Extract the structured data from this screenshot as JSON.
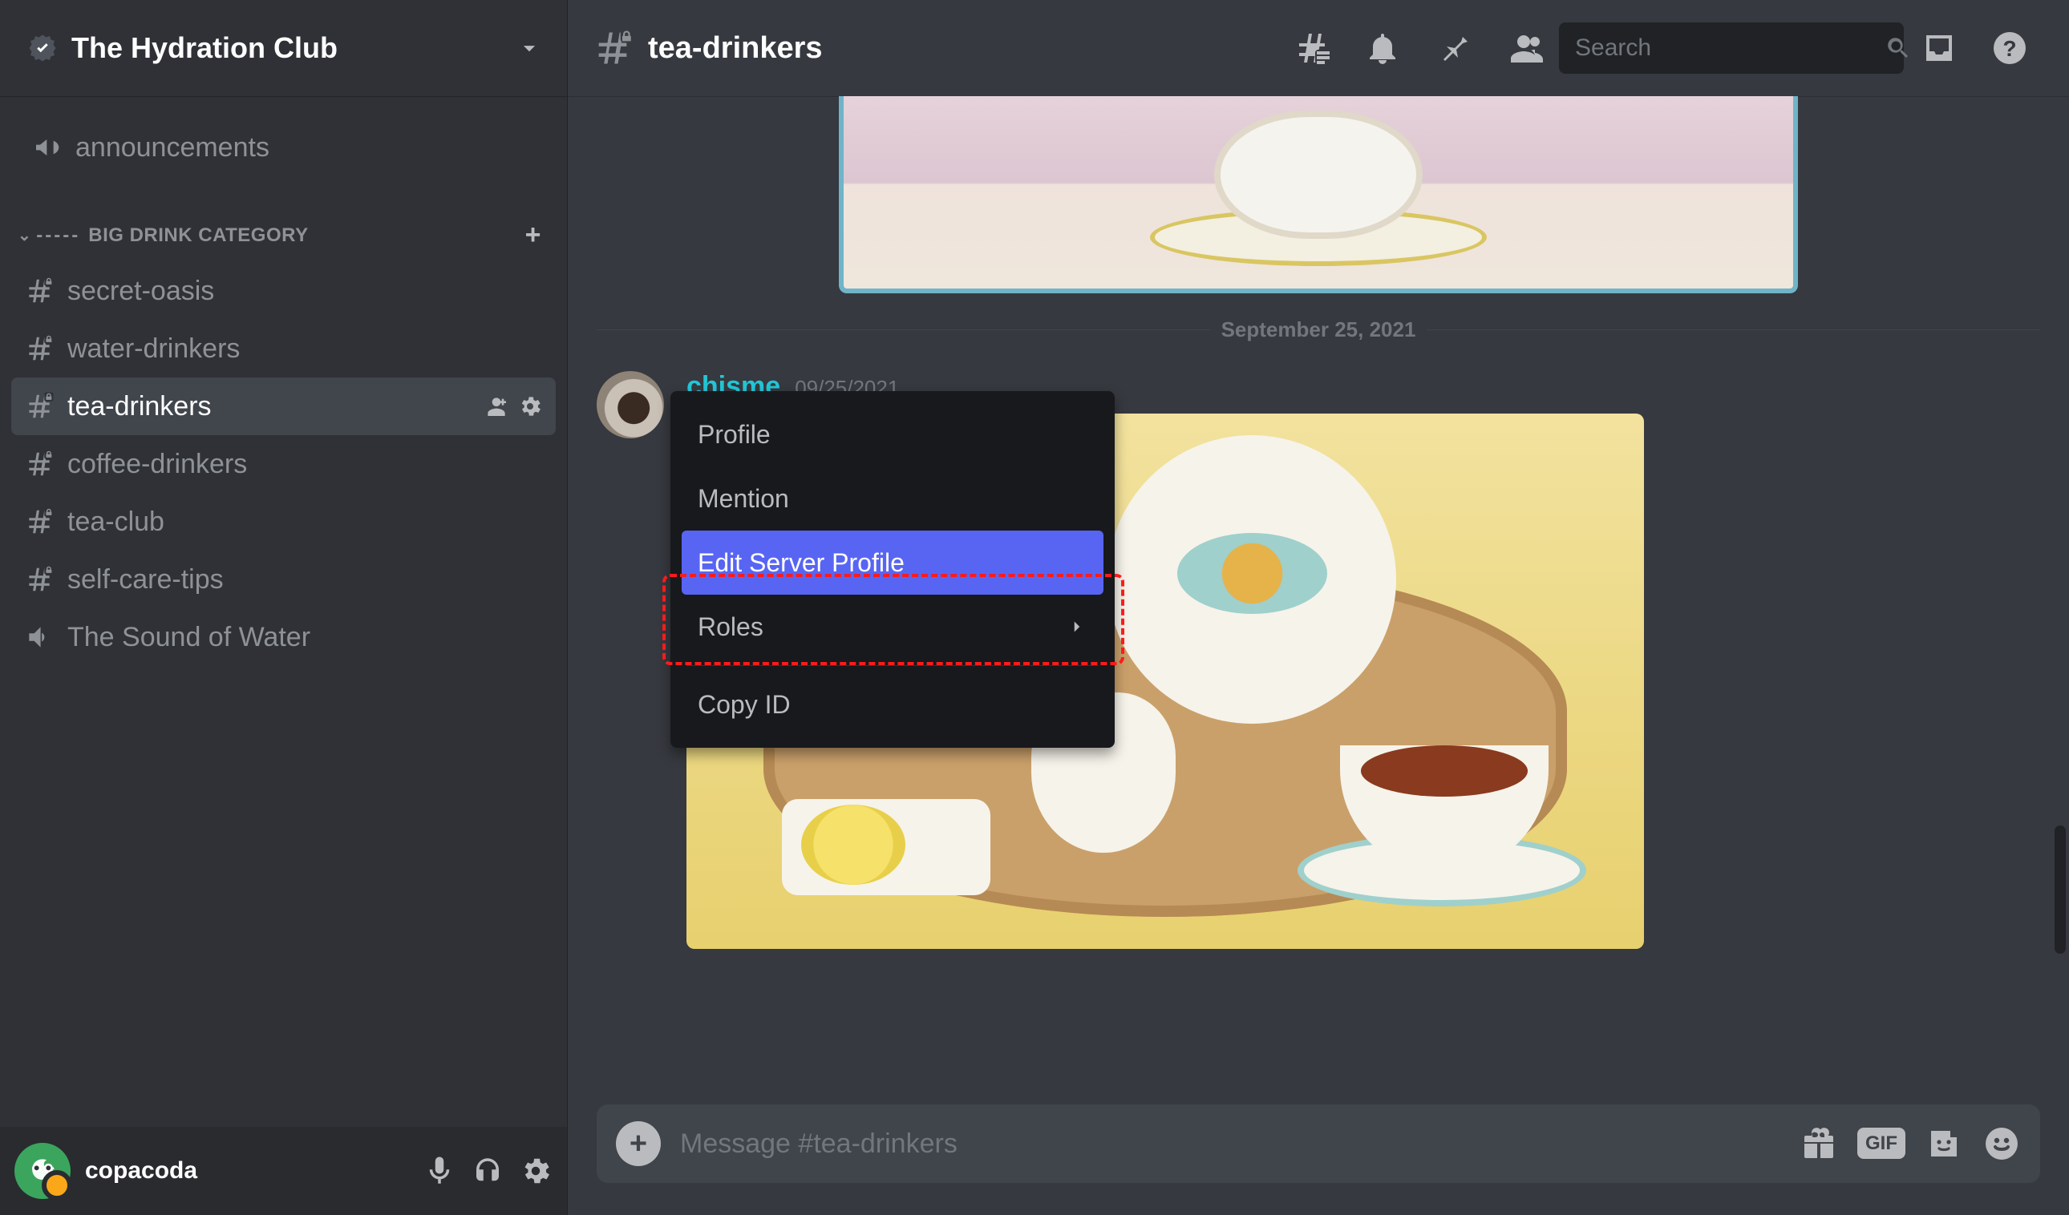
{
  "server": {
    "name": "The Hydration Club"
  },
  "sidebar": {
    "top_channel": {
      "label": "announcements"
    },
    "category": {
      "name": "BIG DRINK CATEGORY",
      "dashes": "-----"
    },
    "channels": [
      {
        "label": "secret-oasis",
        "active": false
      },
      {
        "label": "water-drinkers",
        "active": false
      },
      {
        "label": "tea-drinkers",
        "active": true
      },
      {
        "label": "coffee-drinkers",
        "active": false
      },
      {
        "label": "tea-club",
        "active": false
      },
      {
        "label": "self-care-tips",
        "active": false
      },
      {
        "label": "The Sound of Water",
        "active": false,
        "voice": true
      }
    ]
  },
  "user_panel": {
    "username": "copacoda"
  },
  "topbar": {
    "channel": "tea-drinkers",
    "search_placeholder": "Search"
  },
  "chat": {
    "divider_date": "September 25, 2021",
    "message": {
      "author": "chisme",
      "timestamp": "09/25/2021"
    }
  },
  "context_menu": {
    "items": [
      {
        "label": "Profile",
        "selected": false,
        "submenu": false
      },
      {
        "label": "Mention",
        "selected": false,
        "submenu": false
      },
      {
        "label": "Edit Server Profile",
        "selected": true,
        "submenu": false
      },
      {
        "label": "Roles",
        "selected": false,
        "submenu": true,
        "separator_after": true
      },
      {
        "label": "Copy ID",
        "selected": false,
        "submenu": false
      }
    ]
  },
  "composer": {
    "placeholder": "Message #tea-drinkers",
    "gif_label": "GIF"
  }
}
